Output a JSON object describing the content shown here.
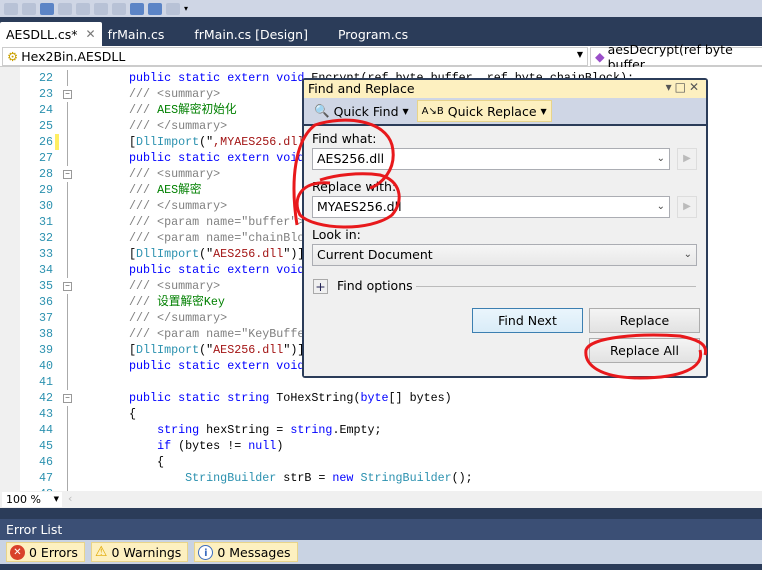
{
  "tabs": [
    {
      "label": "AESDLL.cs*",
      "active": true
    },
    {
      "label": "frMain.cs"
    },
    {
      "label": "frMain.cs [Design]"
    },
    {
      "label": "Program.cs"
    }
  ],
  "nav": {
    "class_combo": "Hex2Bin.AESDLL",
    "member_combo": "aesDecrypt(ref byte buffer"
  },
  "code_lines": [
    {
      "n": "22",
      "segs": [
        [
          "kw",
          "public static extern void"
        ],
        [
          "pl",
          " Encrypt(ref byte buffer, ref byte chainBlock);"
        ]
      ]
    },
    {
      "n": "23",
      "fold": true,
      "segs": [
        [
          "cm",
          "/// <summary>"
        ]
      ]
    },
    {
      "n": "24",
      "segs": [
        [
          "cm",
          "/// "
        ],
        [
          "cn",
          "AES解密初始化"
        ]
      ]
    },
    {
      "n": "25",
      "segs": [
        [
          "cm",
          "/// </summary>"
        ]
      ]
    },
    {
      "n": "26",
      "changed": true,
      "segs": [
        [
          "pl",
          "["
        ],
        [
          "ty",
          "DllImport"
        ],
        [
          "pl",
          "(\""
        ],
        [
          "st",
          ",MYAES256.dll"
        ]
      ]
    },
    {
      "n": "27",
      "segs": [
        [
          "kw",
          "public static extern void"
        ]
      ]
    },
    {
      "n": "28",
      "fold": true,
      "segs": [
        [
          "cm",
          "/// <summary>"
        ]
      ]
    },
    {
      "n": "29",
      "segs": [
        [
          "cm",
          "/// "
        ],
        [
          "cn",
          "AES解密"
        ]
      ]
    },
    {
      "n": "30",
      "segs": [
        [
          "cm",
          "/// </summary>"
        ]
      ]
    },
    {
      "n": "31",
      "segs": [
        [
          "cm",
          "/// <param name=\"buffer\">"
        ]
      ]
    },
    {
      "n": "32",
      "segs": [
        [
          "cm",
          "/// <param name=\"chainBlock"
        ]
      ]
    },
    {
      "n": "33",
      "segs": [
        [
          "pl",
          "["
        ],
        [
          "ty",
          "DllImport"
        ],
        [
          "pl",
          "(\""
        ],
        [
          "st",
          "AES256.dll"
        ],
        [
          "pl",
          "\")]"
        ]
      ]
    },
    {
      "n": "34",
      "segs": [
        [
          "kw",
          "public static extern void"
        ]
      ]
    },
    {
      "n": "35",
      "fold": true,
      "segs": [
        [
          "cm",
          "/// <summary>"
        ]
      ]
    },
    {
      "n": "36",
      "segs": [
        [
          "cm",
          "/// "
        ],
        [
          "cn",
          "设置解密Key"
        ]
      ]
    },
    {
      "n": "37",
      "segs": [
        [
          "cm",
          "/// </summary>"
        ]
      ]
    },
    {
      "n": "38",
      "segs": [
        [
          "cm",
          "/// <param name=\"KeyBuffer"
        ]
      ]
    },
    {
      "n": "39",
      "segs": [
        [
          "pl",
          "["
        ],
        [
          "ty",
          "DllImport"
        ],
        [
          "pl",
          "(\""
        ],
        [
          "st",
          "AES256.dll"
        ],
        [
          "pl",
          "\")]"
        ]
      ]
    },
    {
      "n": "40",
      "segs": [
        [
          "kw",
          "public static extern void"
        ]
      ]
    },
    {
      "n": "41",
      "segs": []
    },
    {
      "n": "42",
      "fold": true,
      "segs": [
        [
          "kw",
          "public static string"
        ],
        [
          "pl",
          " ToHexString("
        ],
        [
          "kw",
          "byte"
        ],
        [
          "pl",
          "[] bytes)"
        ]
      ]
    },
    {
      "n": "43",
      "segs": [
        [
          "pl",
          "{"
        ]
      ]
    },
    {
      "n": "44",
      "segs": [
        [
          "pl",
          "    "
        ],
        [
          "kw",
          "string"
        ],
        [
          "pl",
          " hexString = "
        ],
        [
          "kw",
          "string"
        ],
        [
          "pl",
          ".Empty;"
        ]
      ]
    },
    {
      "n": "45",
      "segs": [
        [
          "pl",
          "    "
        ],
        [
          "kw",
          "if"
        ],
        [
          "pl",
          " (bytes != "
        ],
        [
          "kw",
          "null"
        ],
        [
          "pl",
          ")"
        ]
      ]
    },
    {
      "n": "46",
      "segs": [
        [
          "pl",
          "    {"
        ]
      ]
    },
    {
      "n": "47",
      "segs": [
        [
          "pl",
          "        "
        ],
        [
          "ty",
          "StringBuilder"
        ],
        [
          "pl",
          " strB = "
        ],
        [
          "kw",
          "new"
        ],
        [
          "pl",
          " "
        ],
        [
          "ty",
          "StringBuilder"
        ],
        [
          "pl",
          "();"
        ]
      ]
    },
    {
      "n": "48",
      "segs": []
    }
  ],
  "zoom": "100 %",
  "dialog": {
    "title": "Find and Replace",
    "quick_find": "Quick Find",
    "quick_replace": "Quick Replace",
    "find_label": "Find what:",
    "find_value": "AES256.dll",
    "replace_label": "Replace with:",
    "replace_value": "MYAES256.dll",
    "look_label": "Look in:",
    "look_value": "Current Document",
    "options_label": "Find options",
    "find_next": "Find Next",
    "replace": "Replace",
    "replace_all": "Replace All"
  },
  "error_list": {
    "title": "Error List",
    "errors": "0 Errors",
    "warnings": "0 Warnings",
    "messages": "0 Messages"
  },
  "annotation_color": "#e8191c"
}
